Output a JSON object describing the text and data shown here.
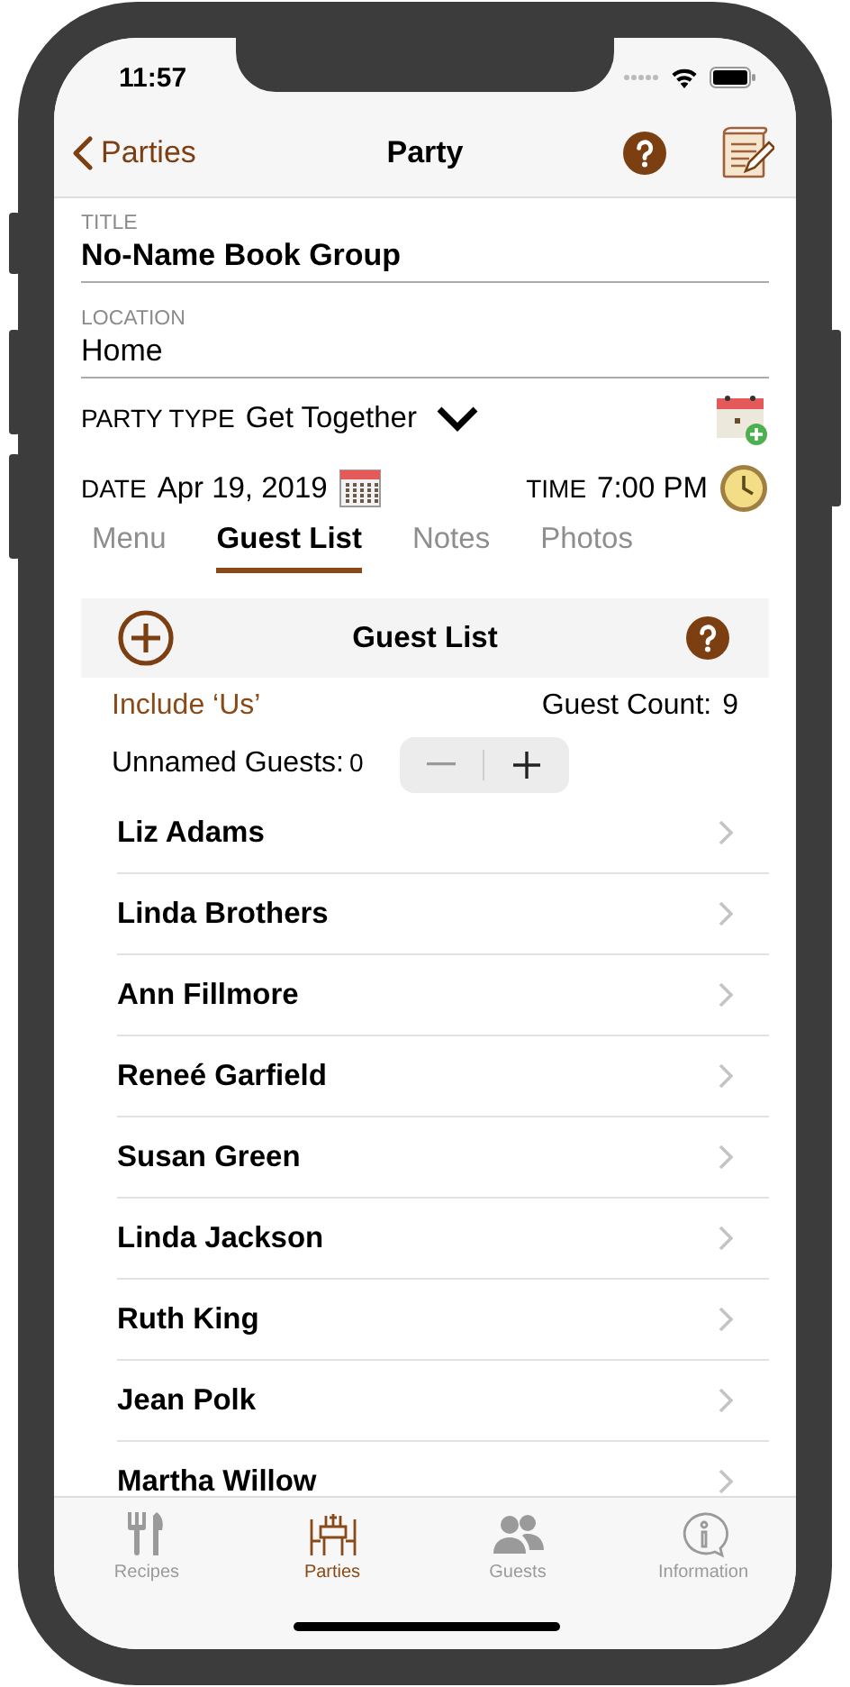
{
  "status_bar": {
    "time": "11:57"
  },
  "nav": {
    "back": "Parties",
    "title": "Party"
  },
  "fields": [
    {
      "label": "TITLE",
      "value": "No-Name Book Group",
      "bold": true
    },
    {
      "label": "LOCATION",
      "value": "Home",
      "bold": false
    }
  ],
  "party_type": {
    "label": "PARTY TYPE",
    "value": "Get Together"
  },
  "date": {
    "label": "DATE",
    "value": "Apr 19, 2019"
  },
  "time": {
    "label": "TIME",
    "value": "7:00 PM"
  },
  "segments": [
    {
      "label": "Menu",
      "selected": false
    },
    {
      "label": "Guest List",
      "selected": true
    },
    {
      "label": "Notes",
      "selected": false
    },
    {
      "label": "Photos",
      "selected": false
    }
  ],
  "guest_list": {
    "title": "Guest List",
    "include_us": "Include ‘Us’",
    "count_label": "Guest Count:",
    "count": "9",
    "unnamed_label": "Unnamed Guests:",
    "unnamed": "0",
    "guests": [
      "Liz Adams",
      "Linda Brothers",
      "Ann Fillmore",
      "Reneé Garfield",
      "Susan Green",
      "Linda Jackson",
      "Ruth King",
      "Jean Polk",
      "Martha Willow"
    ]
  },
  "tab_bar": [
    {
      "label": "Recipes",
      "selected": false
    },
    {
      "label": "Parties",
      "selected": true
    },
    {
      "label": "Guests",
      "selected": false
    },
    {
      "label": "Information",
      "selected": false
    }
  ]
}
